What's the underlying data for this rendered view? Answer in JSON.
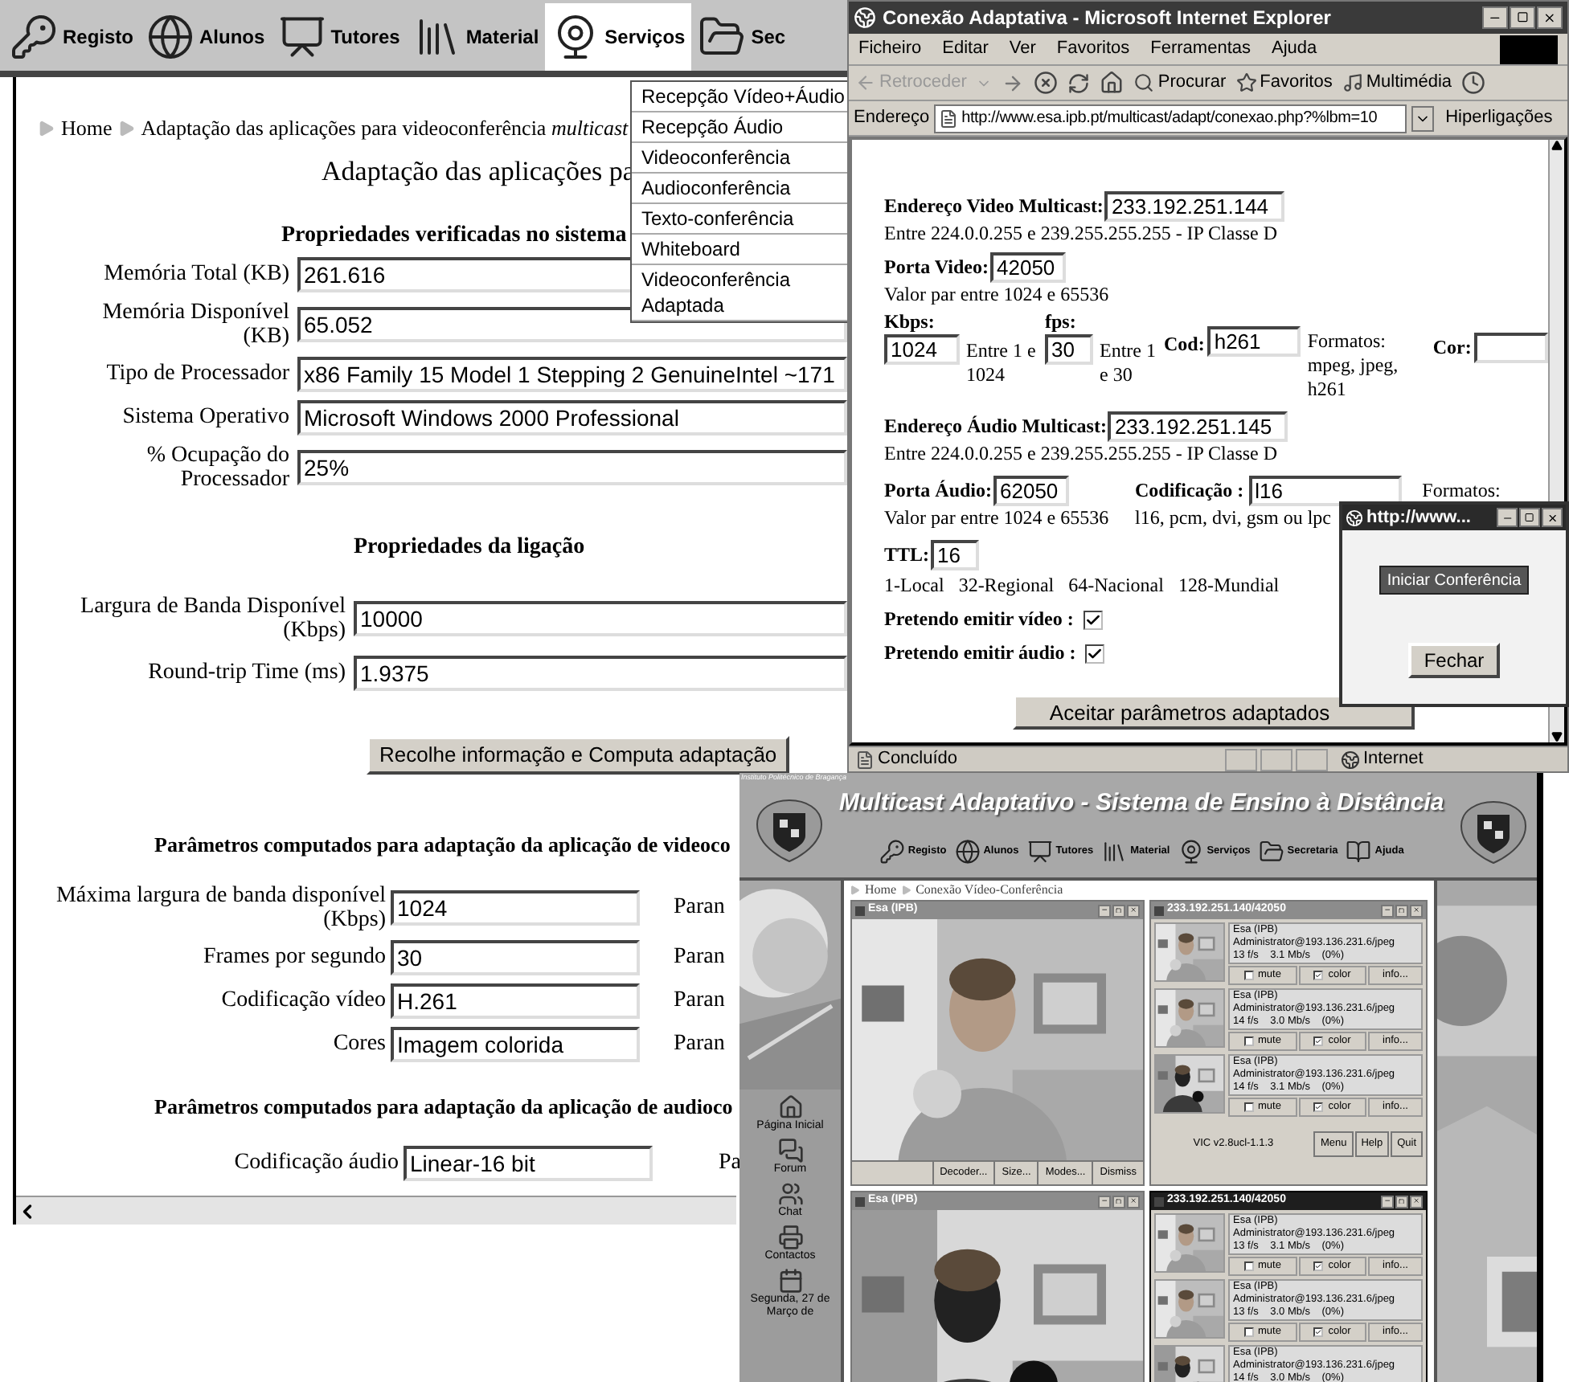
{
  "left_window": {
    "nav": [
      {
        "label": "Registo",
        "selected": false
      },
      {
        "label": "Alunos",
        "selected": false
      },
      {
        "label": "Tutores",
        "selected": false
      },
      {
        "label": "Material",
        "selected": false
      },
      {
        "label": "Serviços",
        "selected": true
      },
      {
        "label": "Sec",
        "selected": false
      }
    ],
    "menu": [
      "Recepção Vídeo+Áudio",
      "Recepção Áudio",
      "Videoconferência",
      "Audioconferência",
      "Texto-conferência",
      "Whiteboard",
      "Videoconferência Adaptada"
    ],
    "breadcrumb": [
      "Home",
      "Adaptação das aplicações para videoconferência *multicast*"
    ],
    "title": "Adaptação das aplicações pa",
    "system": {
      "heading": "Propriedades verificadas no sistema",
      "rows": [
        {
          "label": "Memória Total (KB)",
          "value": "261.616"
        },
        {
          "label": "Memória Disponível (KB)",
          "value": "65.052"
        },
        {
          "label": "Tipo de Processador",
          "value": "x86 Family 15 Model 1 Stepping 2 GenuineIntel ~171"
        },
        {
          "label": "Sistema Operativo",
          "value": "Microsoft Windows 2000 Professional"
        },
        {
          "label": "% Ocupação do Processador",
          "value": "25%"
        }
      ]
    },
    "link": {
      "heading": "Propriedades da ligação",
      "rows": [
        {
          "label": "Largura de Banda Disponível (Kbps)",
          "value": "10000"
        },
        {
          "label": "Round-trip Time (ms)",
          "value": "1.9375"
        }
      ]
    },
    "compute_button": "Recolhe informação e Computa adaptação",
    "video_params": {
      "heading": "Parâmetros computados para adaptação da aplicação de videoco",
      "rows": [
        {
          "label": "Máxima largura de banda disponível (Kbps)",
          "value": "1024",
          "column_3": "Paran"
        },
        {
          "label": "Frames por segundo",
          "value": "30",
          "column_3": "Paran"
        },
        {
          "label": "Codificação vídeo",
          "value": "H.261",
          "column_3": "Paran"
        },
        {
          "label": "Cores",
          "value": "Imagem colorida",
          "column_3": "Paran"
        }
      ]
    },
    "audio_params": {
      "heading": "Parâmetros computados para adaptação da aplicação de audioco",
      "rows": [
        {
          "label": "Codificação áudio",
          "value": "Linear-16 bit",
          "column_3": "Pa"
        }
      ]
    }
  },
  "ie_window": {
    "title": "Conexão Adaptativa - Microsoft Internet Explorer",
    "menu": [
      "Ficheiro",
      "Editar",
      "Ver",
      "Favoritos",
      "Ferramentas",
      "Ajuda"
    ],
    "toolbar": [
      {
        "label": "Retroceder",
        "disabled": true
      },
      {
        "label": "Procurar",
        "disabled": false
      },
      {
        "label": "Favoritos",
        "disabled": false
      },
      {
        "label": "Multimédia",
        "disabled": false
      }
    ],
    "address_label": "Endereço",
    "url": "http://www.esa.ipb.pt/multicast/adapt/conexao.php?%lbm=10",
    "links": "Hiperligações",
    "video_address": {
      "label": "Endereço Video Multicast:",
      "value": "233.192.251.144",
      "hint": "Entre 224.0.0.255 e 239.255.255.255 - IP Classe D"
    },
    "video_port": {
      "label": "Porta Video:",
      "value": "42050",
      "hint": "Valor par entre 1024 e 65536"
    },
    "kbps": {
      "label": "Kbps:",
      "value": "1024",
      "hint": "Entre 1 e 1024"
    },
    "fps": {
      "label": "fps:",
      "value": "30",
      "hint": "Entre 1 e 30"
    },
    "codec": {
      "label": "Cod:",
      "value": "h261",
      "hint": "Formatos: mpeg, jpeg, h261"
    },
    "color": {
      "label": "Cor:"
    },
    "audio_address": {
      "label": "Endereço Áudio Multicast:",
      "value": "233.192.251.145",
      "hint": "Entre 224.0.0.255 e 239.255.255.255 - IP Classe D"
    },
    "audio_port": {
      "label": "Porta Áudio:",
      "value": "62050",
      "hint": "Valor par entre 1024 e 65536"
    },
    "audio_codec": {
      "label": "Codificação :",
      "value": "l16",
      "hint_1": "Formatos:",
      "hint_2": "l16, pcm, dvi, gsm ou lpc"
    },
    "ttl": {
      "label": "TTL:",
      "value": "16",
      "hint": "1-Local   32-Regional   64-Nacional   128-Mundial"
    },
    "checks": [
      {
        "label": "Pretendo emitir vídeo :",
        "checked": true
      },
      {
        "label": "Pretendo emitir áudio :",
        "checked": true
      }
    ],
    "accept_button": "Aceitar parâmetros adaptados",
    "status": "Concluído",
    "zone": "Internet"
  },
  "popup": {
    "title": "http://www...",
    "start_button": "Iniciar Conferência",
    "close_button": "Fechar"
  },
  "portal": {
    "institute": "Instituto Politécnico de Bragança",
    "title": "Multicast Adaptativo - Sistema de Ensino à Distância",
    "nav": [
      "Registo",
      "Alunos",
      "Tutores",
      "Material",
      "Serviços",
      "Secretaria",
      "Ajuda"
    ],
    "sidebar": [
      "Página Inicial",
      "Forum",
      "Chat",
      "Contactos",
      "Segunda, 27 de Março de"
    ],
    "breadcrumb": [
      "Home",
      "Conexão Vídeo-Conferência"
    ],
    "rows": [
      {
        "viewer": {
          "title": "Esa (IPB)",
          "focused": false,
          "buttons": [
            "Decoder...",
            "Size...",
            "Modes...",
            "Dismiss"
          ]
        },
        "list": {
          "title": "233.192.251.140/42050",
          "focused": false,
          "sources": [
            {
              "name": "Esa (IPB)",
              "address": "Administrator@193.136.231.6/jpeg",
              "stats": "13 f/s    3.1 Mb/s    (0%)",
              "mute": false,
              "color": true,
              "mute_label": "mute",
              "color_label": "color",
              "info": "info..."
            },
            {
              "name": "Esa (IPB)",
              "address": "Administrator@193.136.231.6/jpeg",
              "stats": "14 f/s    3.0 Mb/s    (0%)",
              "mute": false,
              "color": true,
              "mute_label": "mute",
              "color_label": "color",
              "info": "info..."
            },
            {
              "name": "Esa (IPB)",
              "address": "Administrator@193.136.231.6/jpeg",
              "stats": "14 f/s    3.1 Mb/s    (0%)",
              "mute": false,
              "color": true,
              "mute_label": "mute",
              "color_label": "color",
              "info": "info..."
            }
          ],
          "version": "VIC v2.8ucl-1.1.3",
          "buttons": [
            "Menu",
            "Help",
            "Quit"
          ]
        }
      },
      {
        "viewer": {
          "title": "Esa (IPB)",
          "focused": false
        },
        "list": {
          "title": "233.192.251.140/42050",
          "focused": true,
          "sources": [
            {
              "name": "Esa (IPB)",
              "address": "Administrator@193.136.231.6/jpeg",
              "stats": "13 f/s    3.1 Mb/s    (0%)",
              "mute": false,
              "color": true,
              "mute_label": "mute",
              "color_label": "color",
              "info": "info..."
            },
            {
              "name": "Esa (IPB)",
              "address": "Administrator@193.136.231.6/jpeg",
              "stats": "13 f/s    3.0 Mb/s    (0%)",
              "mute": false,
              "color": true,
              "mute_label": "mute",
              "color_label": "color",
              "info": "info..."
            },
            {
              "name": "Esa (IPB)",
              "address": "Administrator@193.136.231.6/jpeg",
              "stats": "14 f/s    3.0 Mb/s    (0%)"
            }
          ]
        }
      }
    ]
  }
}
